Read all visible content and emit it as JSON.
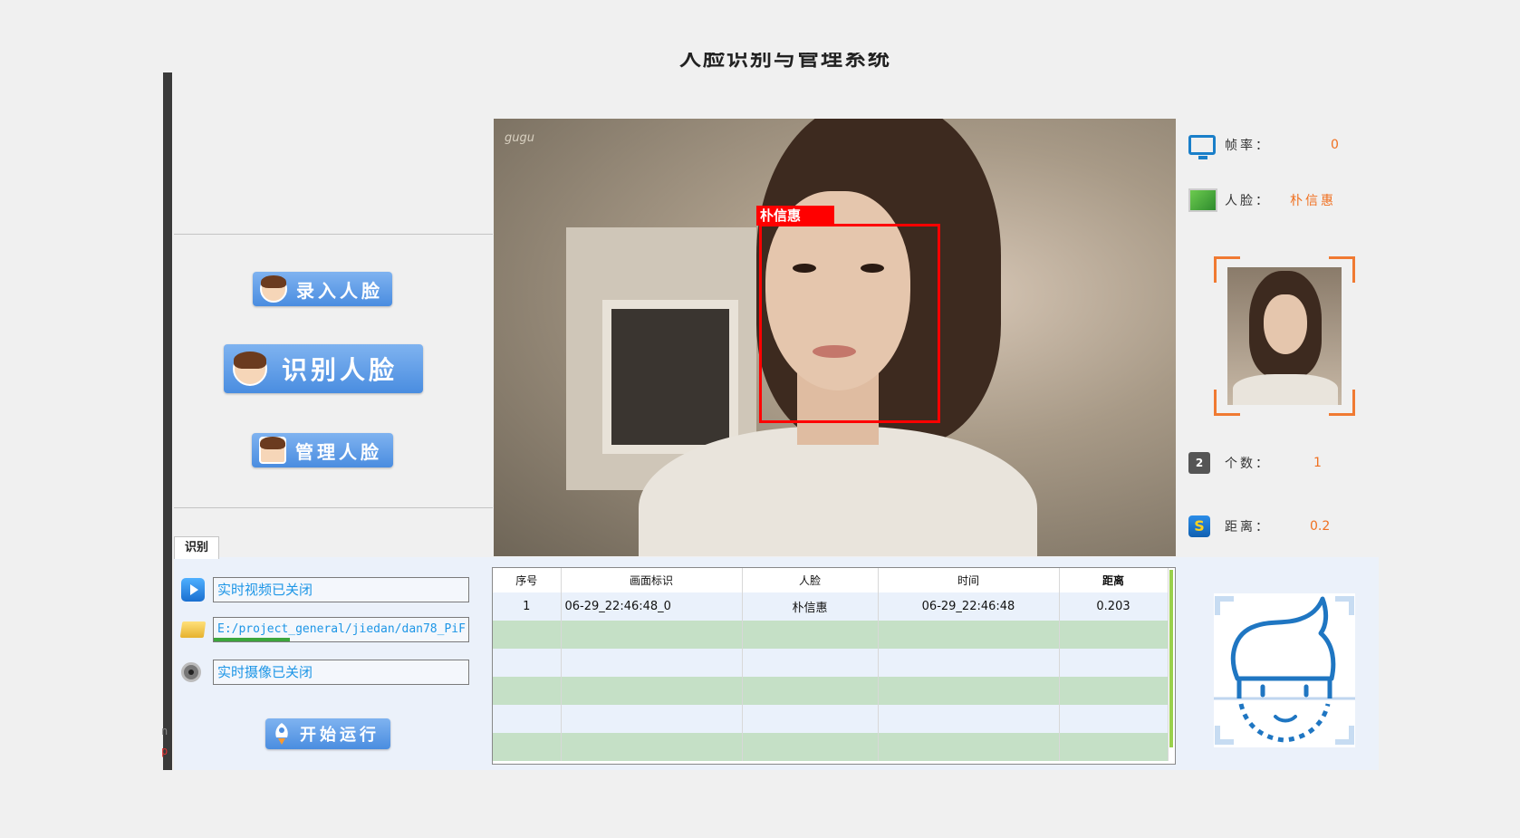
{
  "app": {
    "title": "人脸识别与管理系统"
  },
  "left_panel": {
    "buttons": [
      {
        "label": "录入人脸"
      },
      {
        "label": "识别人脸"
      },
      {
        "label": "管理人脸"
      }
    ]
  },
  "video": {
    "watermark": "gugu",
    "detection_label": "朴信惠"
  },
  "info": {
    "fps": {
      "label": "帧率：",
      "value": "0"
    },
    "face": {
      "label": "人脸：",
      "value": "朴信惠"
    },
    "count": {
      "label": "个数：",
      "value": "1"
    },
    "distance": {
      "label": "距离：",
      "value": "0.2"
    }
  },
  "tabs": [
    {
      "label": "识别"
    }
  ],
  "status": {
    "video": "实时视频已关闭",
    "path": "E:/project_general/jiedan/dan78_PiF",
    "camera": "实时摄像已关闭",
    "path_progress": 0.3
  },
  "run_button": {
    "label": "开始运行"
  },
  "table": {
    "columns": [
      "序号",
      "画面标识",
      "人脸",
      "时间",
      "距离"
    ],
    "rows": [
      [
        "1",
        "06-29_22:46:48_0",
        "朴信惠",
        "06-29_22:46:48",
        "0.203"
      ]
    ]
  },
  "icons": {
    "fps": "monitor-icon",
    "face": "face-map-icon",
    "count": "counter-icon",
    "distance": "distance-icon",
    "video": "play-icon",
    "path": "folder-icon",
    "camera": "webcam-icon",
    "run": "rocket-icon"
  },
  "colors": {
    "accent": "#f07020",
    "status_text": "#1e96e6",
    "button": "#4a8de0",
    "detection": "#ff0000",
    "row_alt": "#c5e0c6"
  }
}
